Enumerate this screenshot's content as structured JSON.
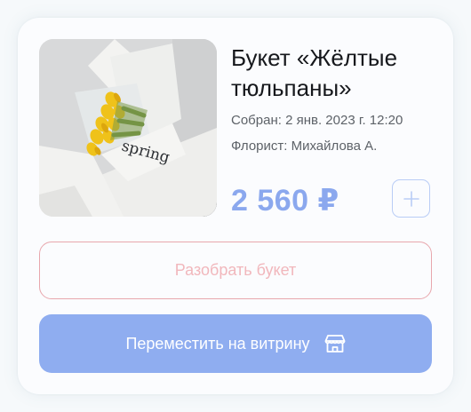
{
  "product": {
    "title": "Букет «Жёлтые тюльпаны»",
    "assembled": "Собран: 2 янв. 2023 г. 12:20",
    "florist": "Флорист: Михайлова А.",
    "price": "2 560 ₽",
    "photo_wrap_text": "spring"
  },
  "actions": {
    "disassemble_label": "Разобрать букет",
    "move_label": "Переместить на витрину"
  },
  "icons": {
    "plus": "plus-icon",
    "storefront": "storefront-icon"
  },
  "colors": {
    "price": "#8ba8ee",
    "primary_button": "#8fadf0",
    "outline_button_border": "#e8a7ad",
    "outline_button_text": "#f1b7bc",
    "plus_border": "#b9cdf6"
  }
}
